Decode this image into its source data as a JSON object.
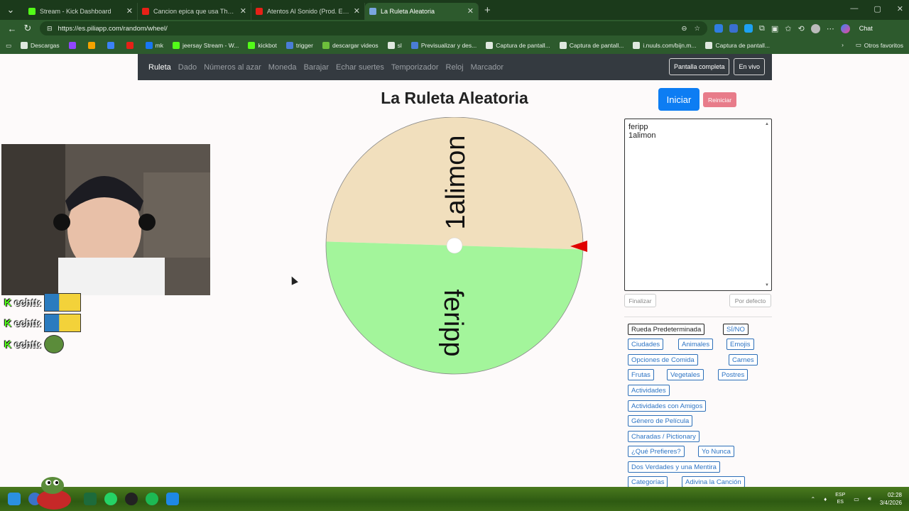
{
  "browser": {
    "tabs": [
      {
        "title": "Stream - Kick Dashboard",
        "color": "#53fc18",
        "active": false
      },
      {
        "title": "Cancion epica que usa TheGrefg",
        "color": "#e62117",
        "active": false
      },
      {
        "title": "Atentos Al Sonido (Prod. Elaiyah)",
        "color": "#e62117",
        "active": false
      },
      {
        "title": "La Ruleta Aleatoria",
        "color": "#7aa6e0",
        "active": true
      }
    ],
    "url": "https://es.piliapp.com/random/wheel/",
    "chat_label": "Chat",
    "bookmarks": [
      {
        "label": "Descargas",
        "color": "#dfe8df"
      },
      {
        "label": "",
        "color": "#9146ff"
      },
      {
        "label": "",
        "color": "#f4a300"
      },
      {
        "label": "",
        "color": "#3b82f6"
      },
      {
        "label": "",
        "color": "#e62117"
      },
      {
        "label": "mk",
        "color": "#1877f2"
      },
      {
        "label": "jeersay Stream - W...",
        "color": "#53fc18"
      },
      {
        "label": "kickbot",
        "color": "#53fc18"
      },
      {
        "label": "trigger",
        "color": "#4a7dd6"
      },
      {
        "label": "descargar videos",
        "color": "#6dbf3b"
      },
      {
        "label": "sl",
        "color": "#dfe8df"
      },
      {
        "label": "Previsualizar y des...",
        "color": "#4a7dd6"
      },
      {
        "label": "Captura de pantall...",
        "color": "#dfe8df"
      },
      {
        "label": "Captura de pantall...",
        "color": "#dfe8df"
      },
      {
        "label": "i.nuuls.com/bijn.m...",
        "color": "#dfe8df"
      },
      {
        "label": "Captura de pantall...",
        "color": "#dfe8df"
      }
    ],
    "other_bookmarks": "Otros favoritos"
  },
  "site": {
    "nav": [
      "Ruleta",
      "Dado",
      "Números al azar",
      "Moneda",
      "Barajar",
      "Echar suertes",
      "Temporizador",
      "Reloj",
      "Marcador"
    ],
    "fullscreen": "Pantalla completa",
    "live": "En vivo",
    "title": "La Ruleta Aleatoria",
    "start": "Iniciar",
    "reset": "Reiniciar",
    "names_text": "feripp\n1alimon",
    "finish": "Finalizar",
    "default": "Por defecto",
    "presets": [
      "Rueda Predeterminada",
      "SÍ/NO",
      "Ciudades",
      "Animales",
      "Emojis",
      "Opciones de Comida",
      "Carnes",
      "Frutas",
      "Vegetales",
      "Postres",
      "Actividades",
      "Actividades con Amigos",
      "Género de Película",
      "Charadas / Pictionary",
      "¿Qué Prefieres?",
      "Yo Nunca",
      "Dos Verdades y una Mentira",
      "Categorías",
      "Adivina la Canción"
    ]
  },
  "wheel": {
    "segments": [
      {
        "label": "1alimon",
        "color": "#f1dfbd"
      },
      {
        "label": "feripp",
        "color": "#a3f59b"
      }
    ],
    "pointer_color": "#e00000"
  },
  "overlay": {
    "chat": [
      {
        "user": "echtt:"
      },
      {
        "user": "echtt:"
      },
      {
        "user": "echtt:"
      }
    ],
    "kick_letter": "K"
  },
  "taskbar": {
    "lang": "ESP",
    "lang2": "ES",
    "time": "02:28",
    "date": "3/4/2026"
  }
}
